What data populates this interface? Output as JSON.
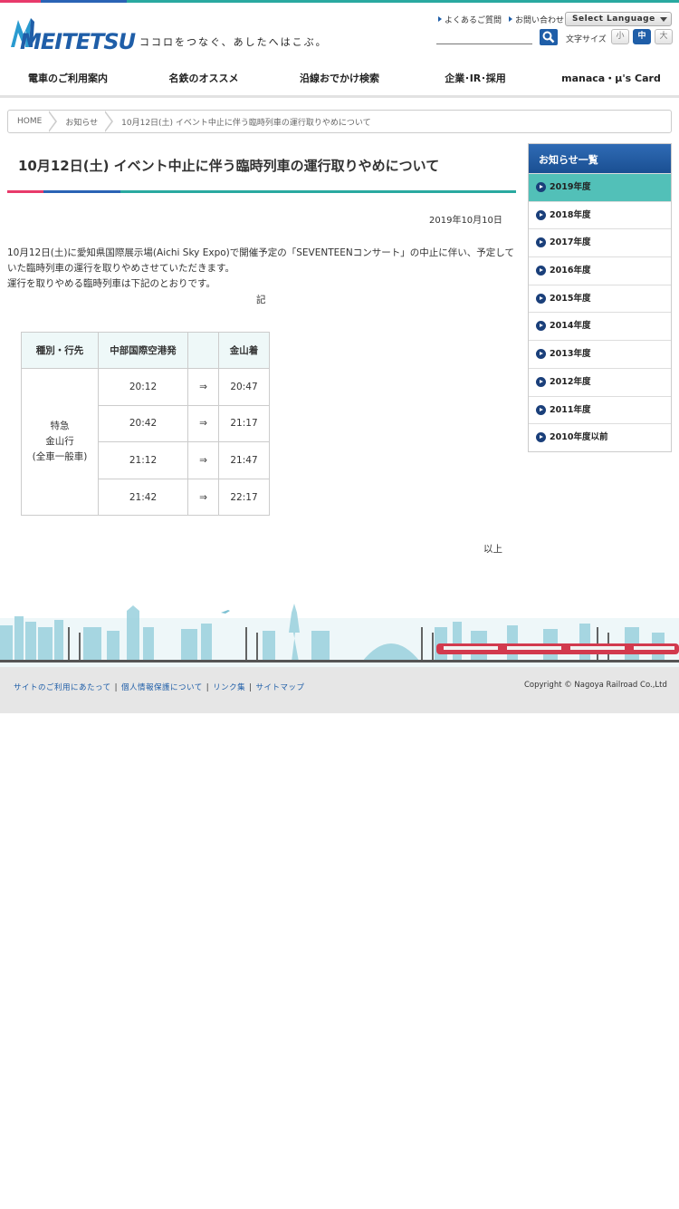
{
  "header": {
    "logo_text": "MEITETSU",
    "tagline": "ココロをつなぐ、あしたへはこぶ。",
    "links": [
      "よくあるご質問",
      "お問い合わせ"
    ],
    "language_label": "Select Language",
    "font_size_label": "文字サイズ",
    "font_sizes": [
      "小",
      "中",
      "大"
    ]
  },
  "nav": [
    "電車のご利用案内",
    "名鉄のオススメ",
    "沿線おでかけ検索",
    "企業･IR･採用",
    "manaca・μ's Card"
  ],
  "breadcrumb": [
    "HOME",
    "お知らせ",
    "10月12日(土) イベント中止に伴う臨時列車の運行取りやめについて"
  ],
  "article": {
    "title": "10月12日(土) イベント中止に伴う臨時列車の運行取りやめについて",
    "date": "2019年10月10日",
    "paragraph1": "10月12日(土)に愛知県国際展示場(Aichi Sky Expo)で開催予定の「SEVENTEENコンサート」の中止に伴い、予定していた臨時列車の運行を取りやめさせていただきます。",
    "paragraph2": "運行を取りやめる臨時列車は下記のとおりです。",
    "ki": "記",
    "ijo": "以上",
    "table": {
      "headers": [
        "種別・行先",
        "中部国際空港発",
        "",
        "金山着"
      ],
      "type_lines": [
        "特急",
        "金山行",
        "(全車一般車)"
      ],
      "arrow": "⇒",
      "rows": [
        {
          "dep": "20:12",
          "arr": "20:47"
        },
        {
          "dep": "20:42",
          "arr": "21:17"
        },
        {
          "dep": "21:12",
          "arr": "21:47"
        },
        {
          "dep": "21:42",
          "arr": "22:17"
        }
      ]
    }
  },
  "sidebar": {
    "title": "お知らせ一覧",
    "items": [
      "2019年度",
      "2018年度",
      "2017年度",
      "2016年度",
      "2015年度",
      "2014年度",
      "2013年度",
      "2012年度",
      "2011年度",
      "2010年度以前"
    ]
  },
  "footer": {
    "links": [
      "サイトのご利用にあたって",
      "個人情報保護について",
      "リンク集",
      "サイトマップ"
    ],
    "copyright": "Copyright © Nagoya Railroad Co.,Ltd"
  },
  "colors": {
    "brand_blue": "#1f5ea8",
    "accent_pink": "#e83a6b",
    "accent_teal": "#29a9a0",
    "sidebar_active": "#52c0b8"
  }
}
